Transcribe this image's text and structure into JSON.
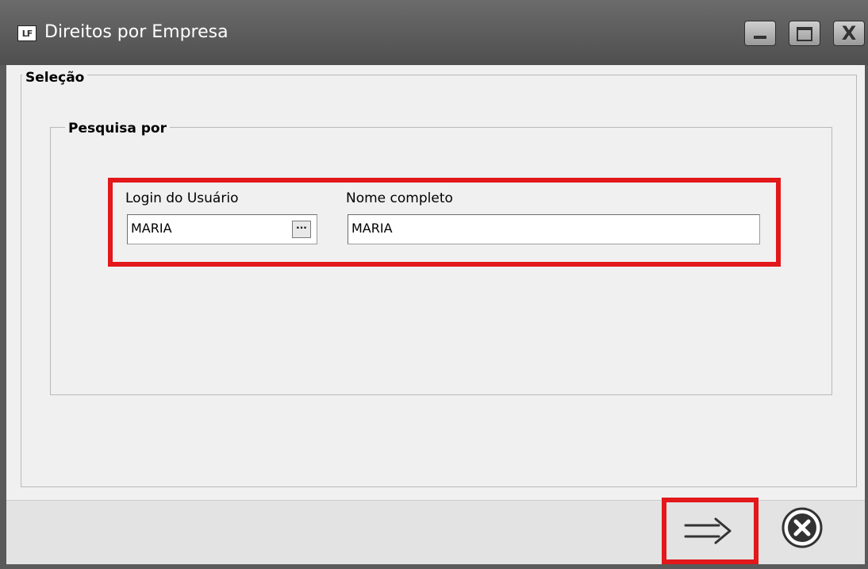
{
  "window": {
    "title": "Direitos por Empresa",
    "app_icon_text": "LF",
    "close_symbol": "X"
  },
  "selecao": {
    "title": "Seleção"
  },
  "pesquisa": {
    "title": "Pesquisa por",
    "login_label": "Login do Usuário",
    "login_value": "MARIA",
    "lookup_label": "···",
    "nome_label": "Nome completo",
    "nome_value": "MARIA"
  },
  "footer": {
    "next_icon": "double-arrow-right-icon",
    "cancel_icon": "cancel-circle-icon"
  },
  "colors": {
    "highlight": "#e2181b",
    "titlebar": "#5a5a5a",
    "panel": "#f0f0f0"
  }
}
